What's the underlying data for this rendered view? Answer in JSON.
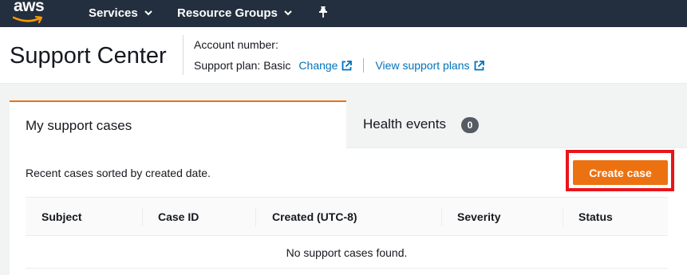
{
  "nav": {
    "logo_text": "aws",
    "services_label": "Services",
    "resource_groups_label": "Resource Groups"
  },
  "header": {
    "title": "Support Center",
    "account_label": "Account number:",
    "plan_label": "Support plan:",
    "plan_value": "Basic",
    "change_link": "Change",
    "view_plans_link": "View support plans"
  },
  "tabs": [
    {
      "label": "My support cases",
      "active": true
    },
    {
      "label": "Health events",
      "count": "0",
      "active": false
    }
  ],
  "cases": {
    "caption": "Recent cases sorted by created date.",
    "create_button": "Create case",
    "columns": [
      "Subject",
      "Case ID",
      "Created (UTC-8)",
      "Severity",
      "Status"
    ],
    "empty_message": "No support cases found."
  },
  "colors": {
    "nav_bg": "#232f3e",
    "accent": "#ec7211",
    "link": "#0073bb",
    "highlight": "#e8151b"
  }
}
